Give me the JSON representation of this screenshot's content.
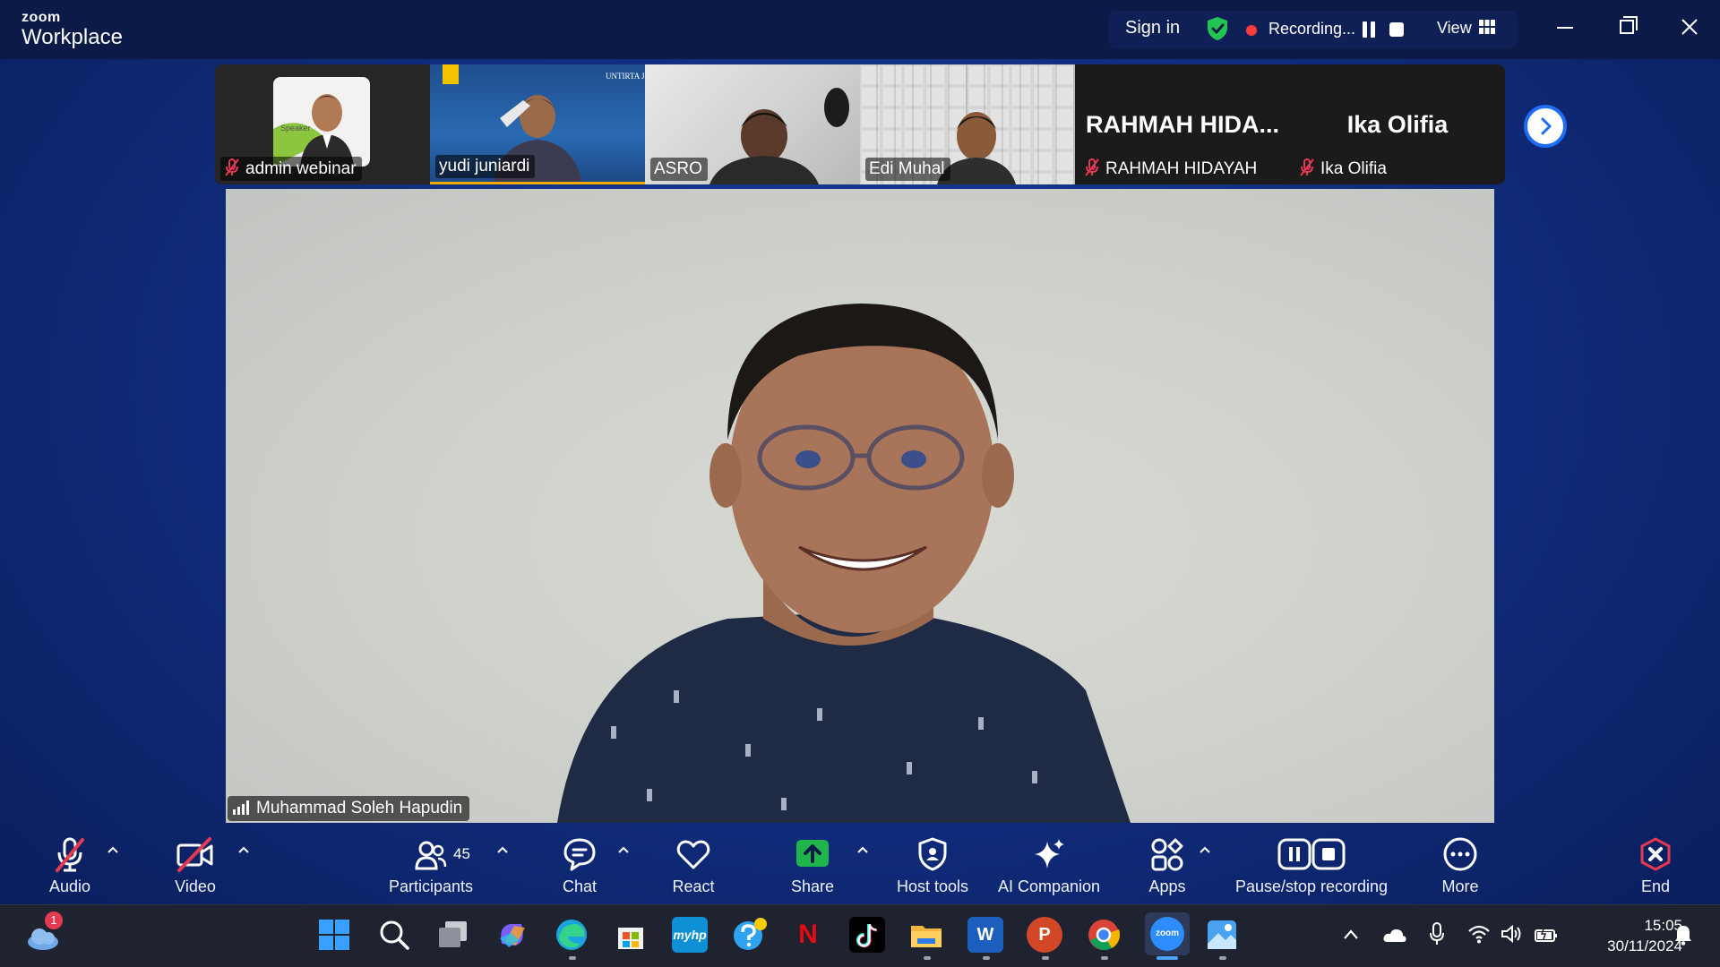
{
  "app": {
    "brand_small": "zoom",
    "brand_large": "Workplace"
  },
  "titlebar": {
    "sign_in": "Sign in",
    "recording_status": "Recording...",
    "view_label": "View",
    "icons": [
      "shield-check-icon",
      "pause-icon",
      "stop-icon",
      "grid-icon",
      "minimize-icon",
      "restore-icon",
      "close-icon"
    ],
    "colors": {
      "background": "#0b1a47",
      "shield": "#23c552",
      "record_dot": "#ff3b3b"
    }
  },
  "gallery": {
    "participants": [
      {
        "name": "admin webinar",
        "muted": true,
        "card_text": "Speaker"
      },
      {
        "name": "yudi juniardi",
        "muted": false,
        "badge_text": "UNTIRTA Jawara"
      },
      {
        "name": "ASRO",
        "muted": false
      },
      {
        "name": "Edi Muhal",
        "muted": false
      },
      {
        "name": "RAHMAH HIDAYAH",
        "display_name": "RAHMAH  HIDA...",
        "muted": true
      },
      {
        "name": "Ika Olifia",
        "display_name": "Ika Olifia",
        "muted": true
      }
    ],
    "next_page_icon": "chevron-right-icon"
  },
  "main_video": {
    "speaker": "Muhammad Soleh Hapudin",
    "signal_icon": "signal-bars-icon"
  },
  "toolbar": {
    "audio": "Audio",
    "video": "Video",
    "participants": "Participants",
    "participants_count": "45",
    "chat": "Chat",
    "react": "React",
    "share": "Share",
    "host_tools": "Host tools",
    "ai_companion": "AI Companion",
    "apps": "Apps",
    "pause_stop_recording": "Pause/stop recording",
    "more": "More",
    "end": "End",
    "colors": {
      "share": "#1fb54a",
      "end": "#e5394f",
      "muted": "#e5394f"
    }
  },
  "taskbar": {
    "weather_badge": "1",
    "time": "15:05",
    "date": "30/11/2024",
    "apps": [
      "windows-start-icon",
      "search-icon",
      "task-view-icon",
      "copilot-icon",
      "edge-icon",
      "microsoft-store-icon",
      "myhp-icon",
      "get-help-icon",
      "netflix-icon",
      "tiktok-icon",
      "file-explorer-icon",
      "word-icon",
      "powerpoint-icon",
      "chrome-icon",
      "zoom-icon",
      "photos-icon"
    ],
    "myhp_label": "myhp",
    "zoom_label": "zoom",
    "word_label": "W",
    "powerpoint_label": "P",
    "netflix_label": "N",
    "tray_icons": [
      "chevron-up-icon",
      "onedrive-icon",
      "microphone-icon",
      "wifi-icon",
      "volume-icon",
      "battery-icon",
      "notification-bell-icon"
    ]
  }
}
